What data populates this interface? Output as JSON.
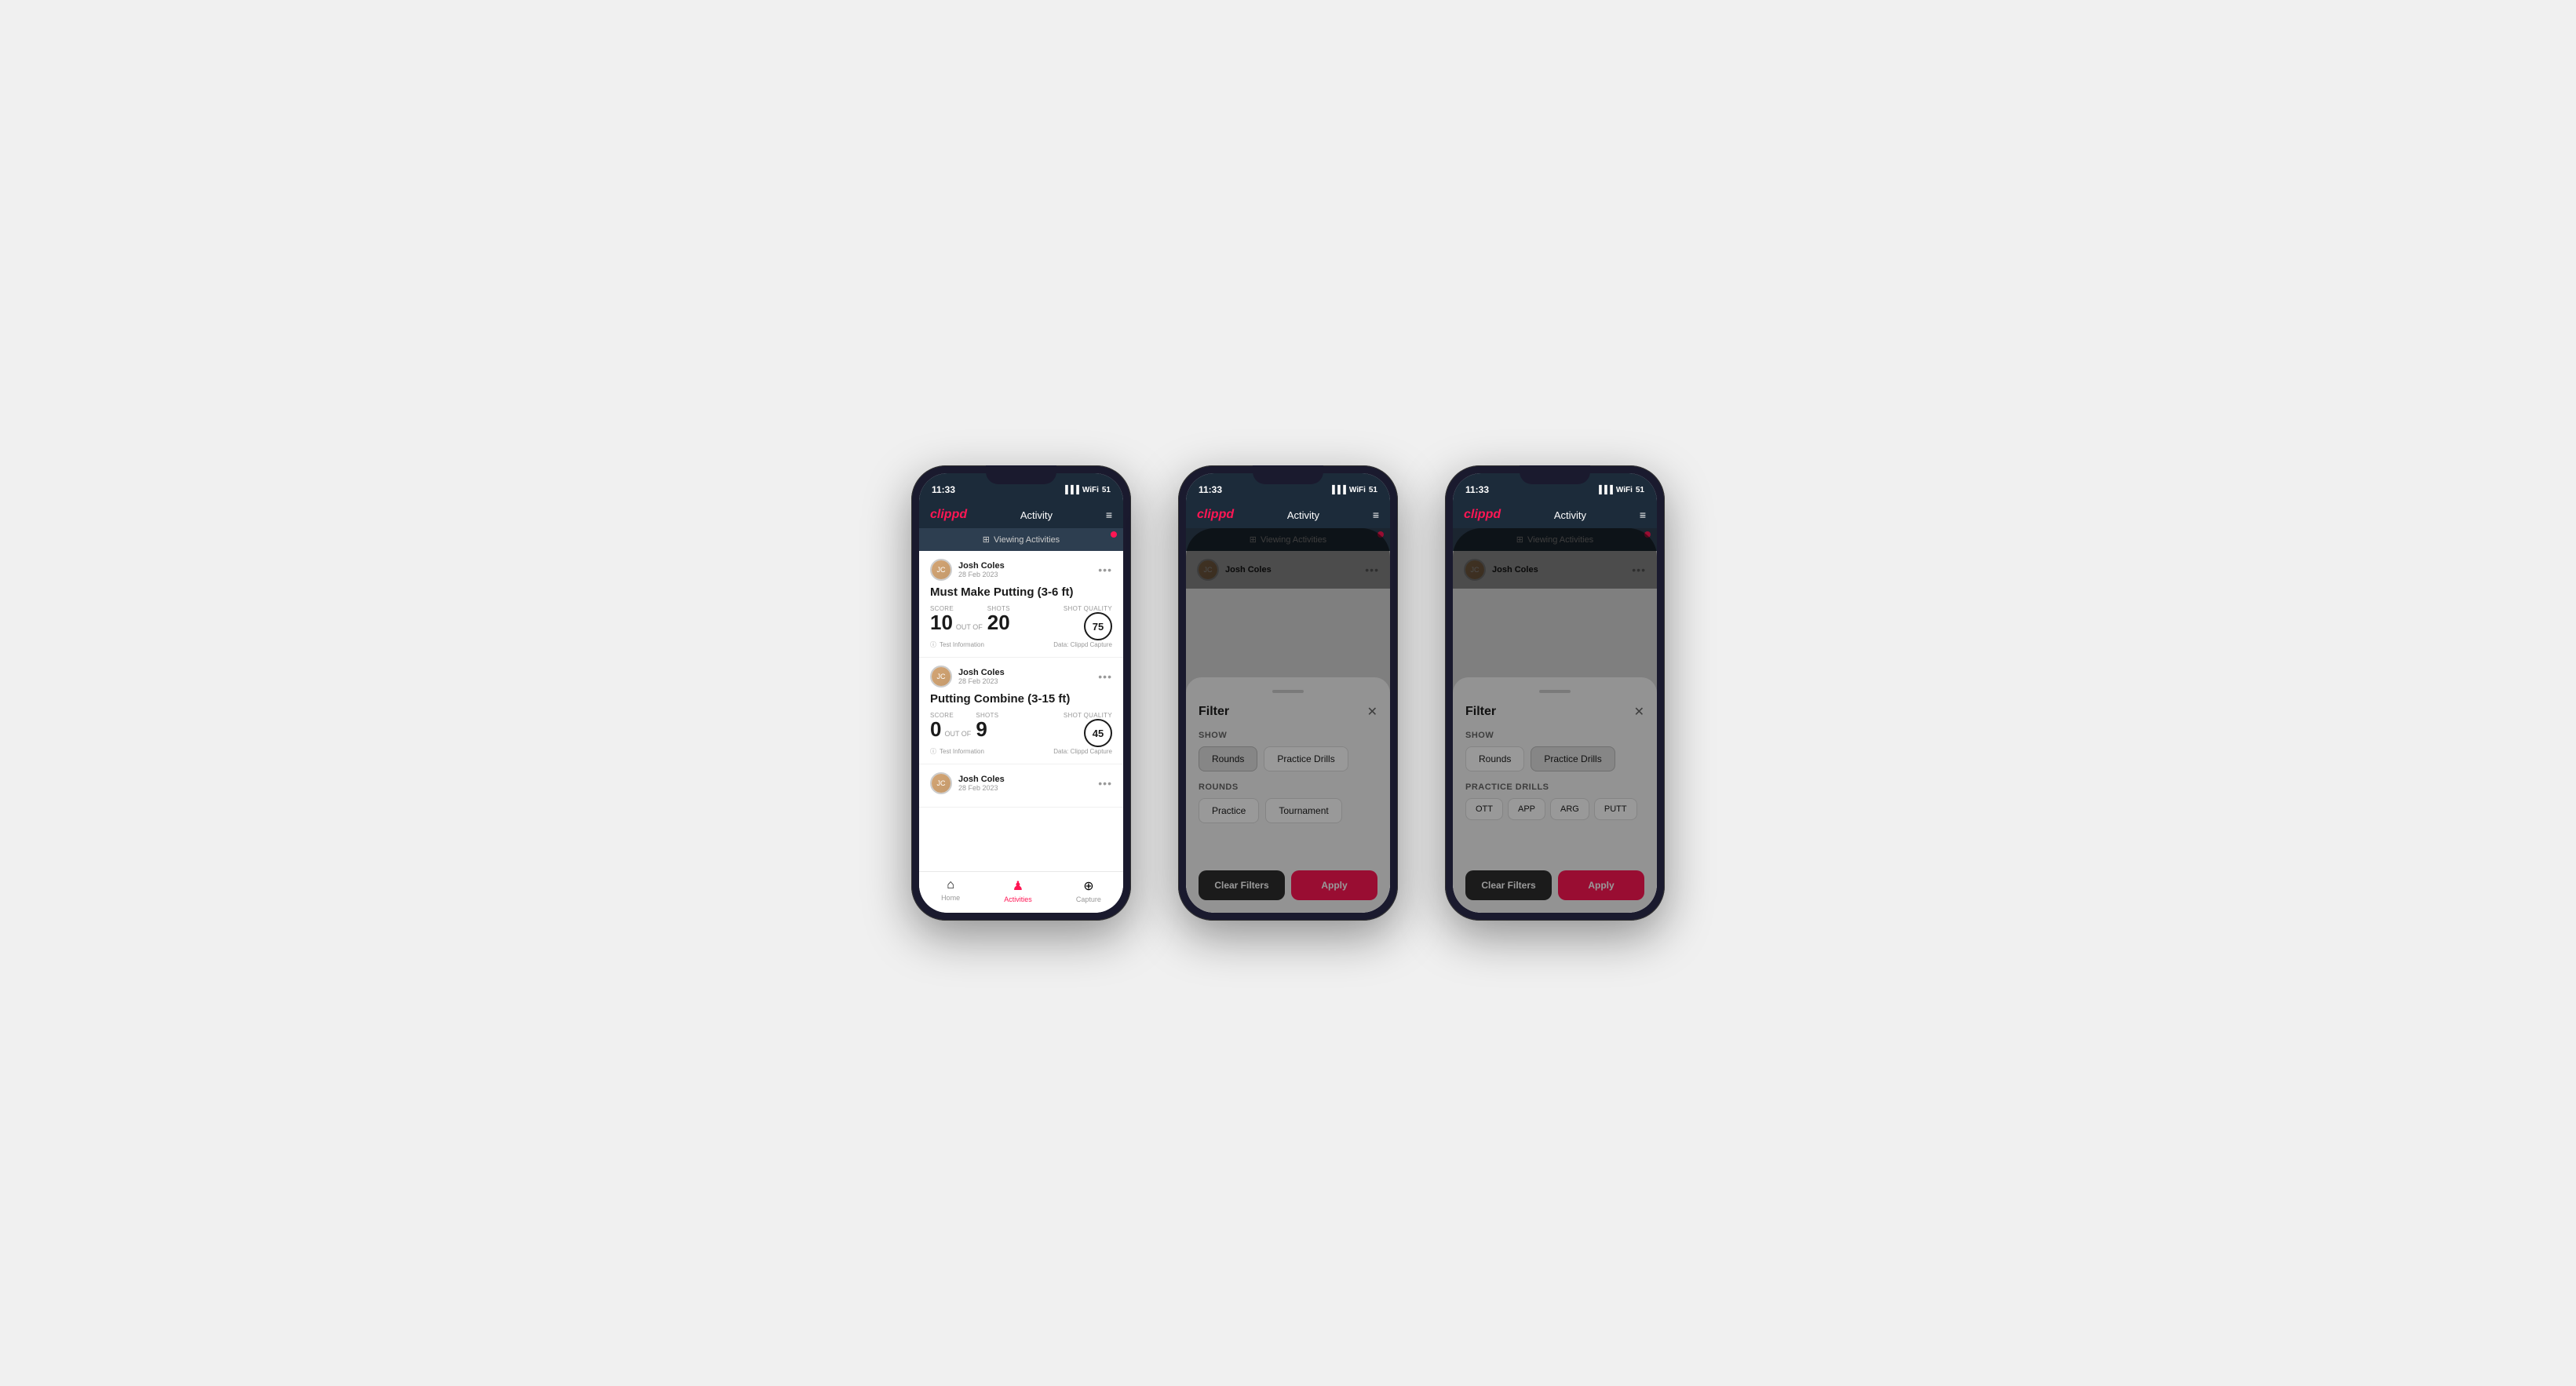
{
  "screens": [
    {
      "id": "screen1",
      "type": "activity-list",
      "statusBar": {
        "time": "11:33",
        "signal": "▐▐▐",
        "wifi": "WiFi",
        "battery": "51"
      },
      "header": {
        "logo": "clippd",
        "title": "Activity",
        "menuIcon": "≡"
      },
      "viewingBar": {
        "icon": "⊞",
        "text": "Viewing Activities"
      },
      "activities": [
        {
          "userName": "Josh Coles",
          "userDate": "28 Feb 2023",
          "title": "Must Make Putting (3-6 ft)",
          "scorelabel": "Score",
          "score": "10",
          "outOf": "OUT OF",
          "shots": "20",
          "shotsLabel": "Shots",
          "shotQuality": "75",
          "shotQualityLabel": "Shot Quality",
          "info": "Test Information",
          "dataSource": "Data: Clippd Capture"
        },
        {
          "userName": "Josh Coles",
          "userDate": "28 Feb 2023",
          "title": "Putting Combine (3-15 ft)",
          "scorelabel": "Score",
          "score": "0",
          "outOf": "OUT OF",
          "shots": "9",
          "shotsLabel": "Shots",
          "shotQuality": "45",
          "shotQualityLabel": "Shot Quality",
          "info": "Test Information",
          "dataSource": "Data: Clippd Capture"
        },
        {
          "userName": "Josh Coles",
          "userDate": "28 Feb 2023",
          "title": "",
          "scorelabel": "",
          "score": "",
          "outOf": "",
          "shots": "",
          "shotsLabel": "",
          "shotQuality": "",
          "shotQualityLabel": "",
          "info": "",
          "dataSource": ""
        }
      ],
      "bottomNav": [
        {
          "icon": "⌂",
          "label": "Home",
          "active": false
        },
        {
          "icon": "♟",
          "label": "Activities",
          "active": true
        },
        {
          "icon": "+",
          "label": "Capture",
          "active": false
        }
      ]
    },
    {
      "id": "screen2",
      "type": "filter-rounds",
      "statusBar": {
        "time": "11:33",
        "signal": "▐▐▐",
        "wifi": "WiFi",
        "battery": "51"
      },
      "header": {
        "logo": "clippd",
        "title": "Activity",
        "menuIcon": "≡"
      },
      "viewingBar": {
        "icon": "⊞",
        "text": "Viewing Activities"
      },
      "filter": {
        "title": "Filter",
        "showLabel": "Show",
        "showButtons": [
          {
            "label": "Rounds",
            "active": true
          },
          {
            "label": "Practice Drills",
            "active": false
          }
        ],
        "roundsLabel": "Rounds",
        "roundsButtons": [
          {
            "label": "Practice",
            "active": false
          },
          {
            "label": "Tournament",
            "active": false
          }
        ],
        "clearLabel": "Clear Filters",
        "applyLabel": "Apply"
      }
    },
    {
      "id": "screen3",
      "type": "filter-drills",
      "statusBar": {
        "time": "11:33",
        "signal": "▐▐▐",
        "wifi": "WiFi",
        "battery": "51"
      },
      "header": {
        "logo": "clippd",
        "title": "Activity",
        "menuIcon": "≡"
      },
      "viewingBar": {
        "icon": "⊞",
        "text": "Viewing Activities"
      },
      "filter": {
        "title": "Filter",
        "showLabel": "Show",
        "showButtons": [
          {
            "label": "Rounds",
            "active": false
          },
          {
            "label": "Practice Drills",
            "active": true
          }
        ],
        "drillsLabel": "Practice Drills",
        "drillButtons": [
          {
            "label": "OTT",
            "active": false
          },
          {
            "label": "APP",
            "active": false
          },
          {
            "label": "ARG",
            "active": false
          },
          {
            "label": "PUTT",
            "active": false
          }
        ],
        "clearLabel": "Clear Filters",
        "applyLabel": "Apply"
      }
    }
  ]
}
